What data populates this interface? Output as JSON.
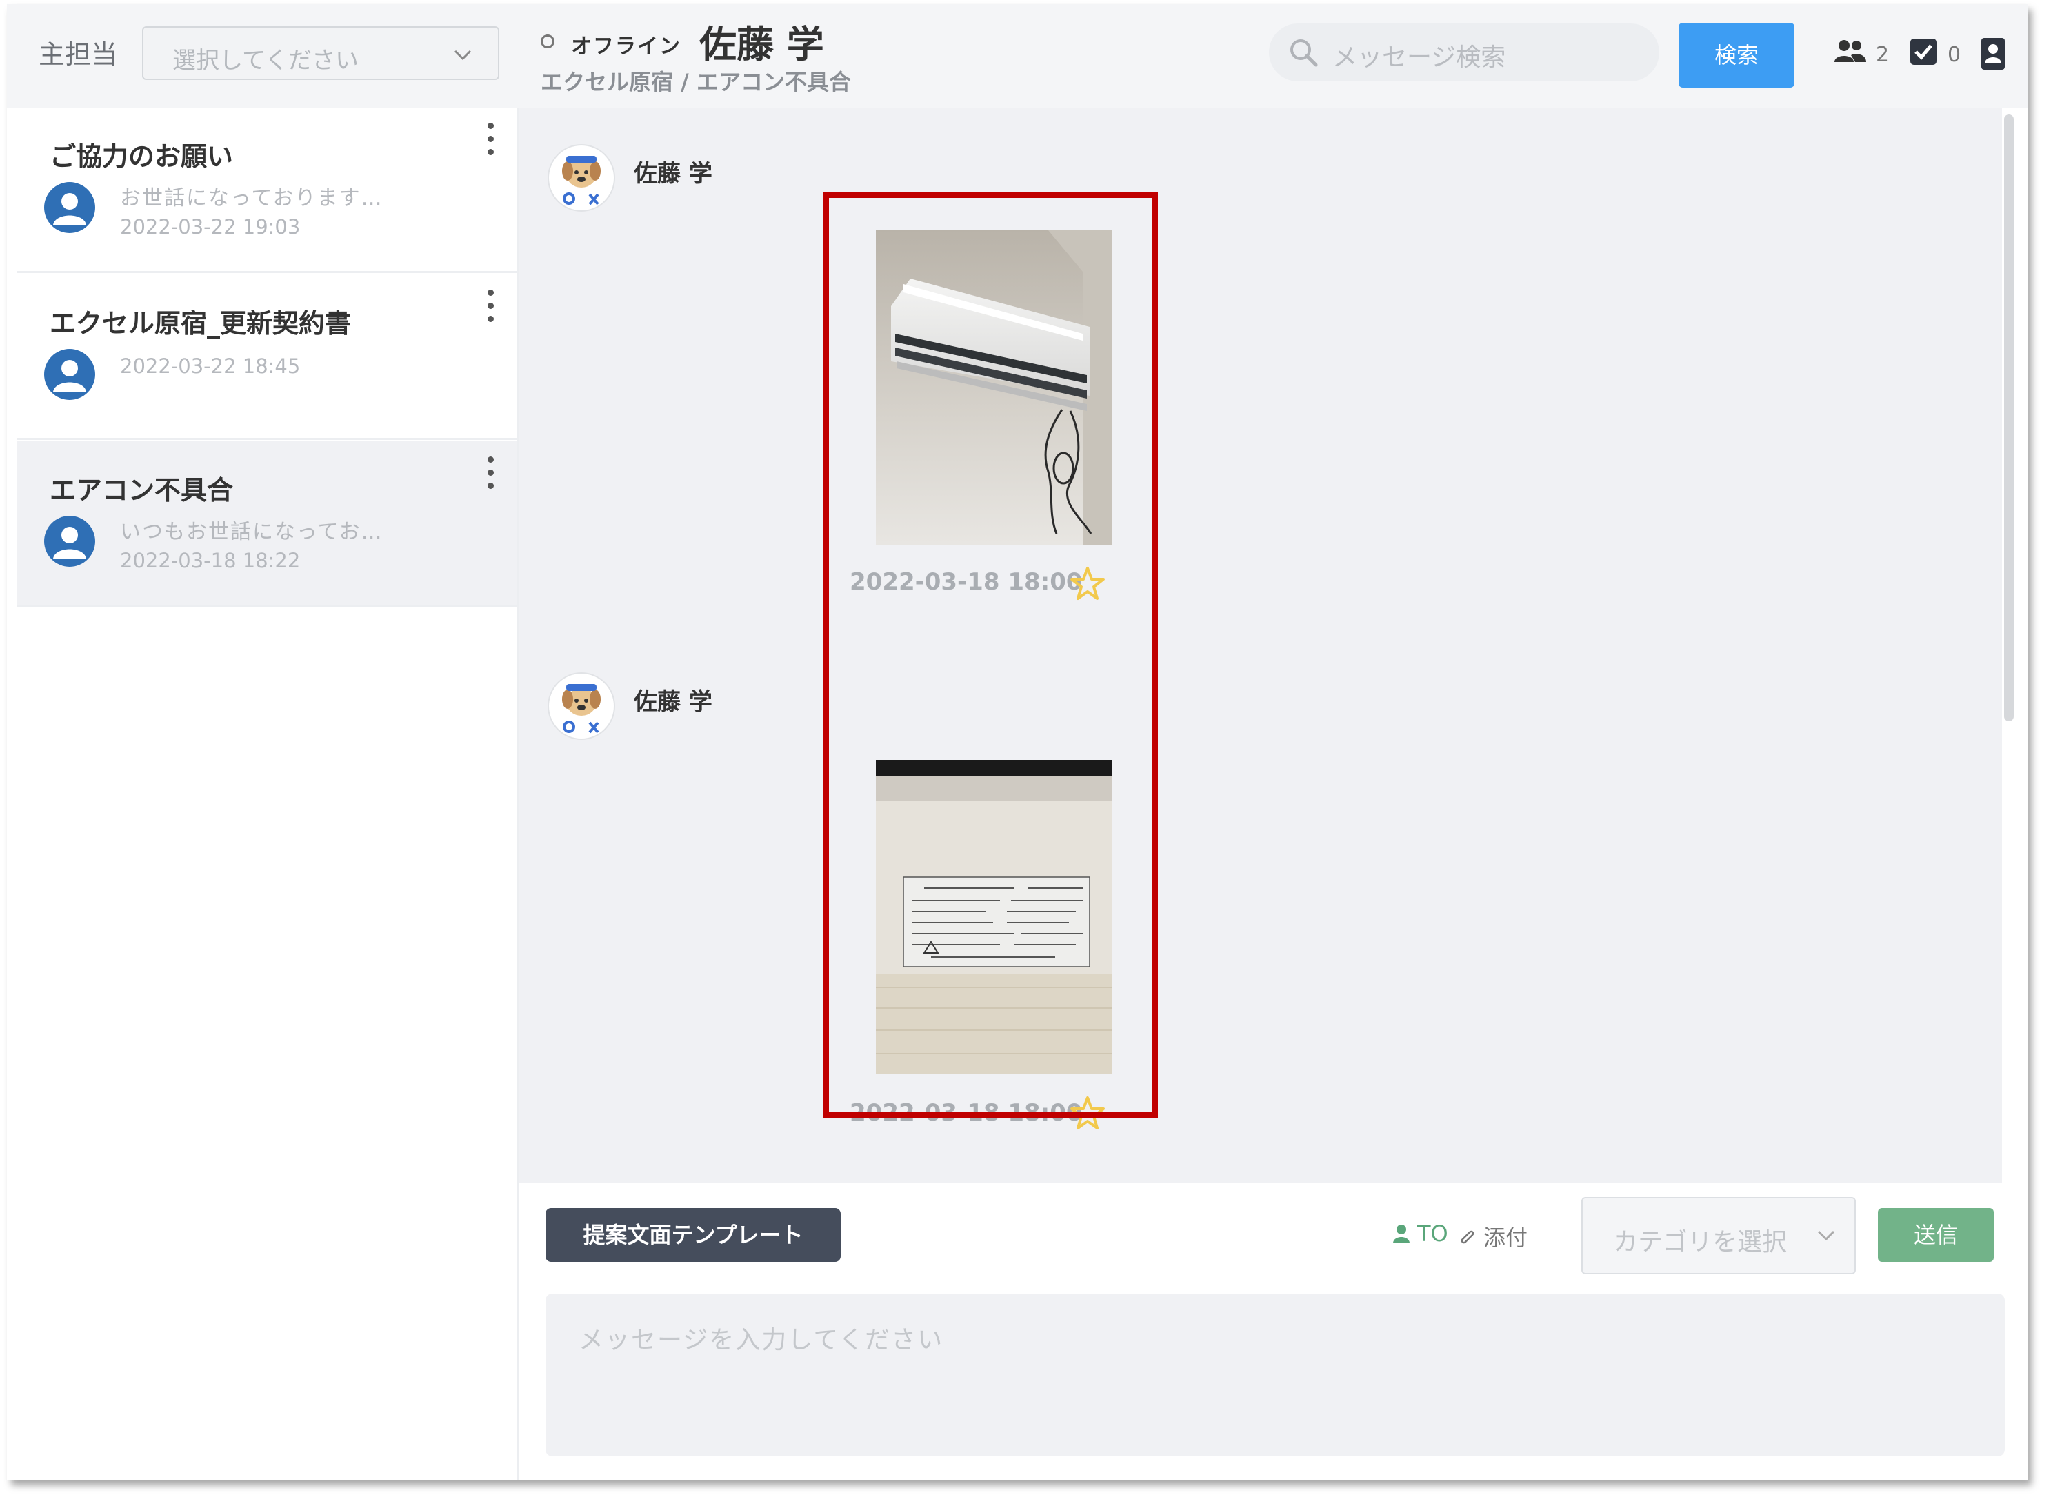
{
  "header": {
    "assignee_label": "主担当",
    "assignee_placeholder": "選択してください",
    "status": "オフライン",
    "contact_name": "佐藤 学",
    "breadcrumb": "エクセル原宿 / エアコン不具合",
    "search_placeholder": "メッセージ検索",
    "search_button": "検索",
    "members_count": "2",
    "tasks_count": "0"
  },
  "threads": [
    {
      "title": "ご協力のお願い",
      "preview": "お世話になっております…",
      "date": "2022-03-22 19:03"
    },
    {
      "title": "エクセル原宿_更新契約書",
      "preview": "",
      "date": "2022-03-22 18:45"
    },
    {
      "title": "エアコン不具合",
      "preview": "いつもお世話になってお…",
      "date": "2022-03-18 18:22"
    }
  ],
  "messages": [
    {
      "sender": "佐藤 学",
      "image": "air-conditioner-photo",
      "time": "2022-03-18 18:00"
    },
    {
      "sender": "佐藤 学",
      "image": "spec-label-photo",
      "time": "2022-03-18 18:00"
    }
  ],
  "composer": {
    "template_button": "提案文面テンプレート",
    "to_label": "TO",
    "attach_label": "添付",
    "category_placeholder": "カテゴリを選択",
    "send_button": "送信",
    "message_placeholder": "メッセージを入力してください"
  },
  "colors": {
    "accent_blue": "#3d9df3",
    "send_green": "#72b389",
    "highlight_red": "#c00000",
    "star_yellow": "#f2c94c"
  }
}
